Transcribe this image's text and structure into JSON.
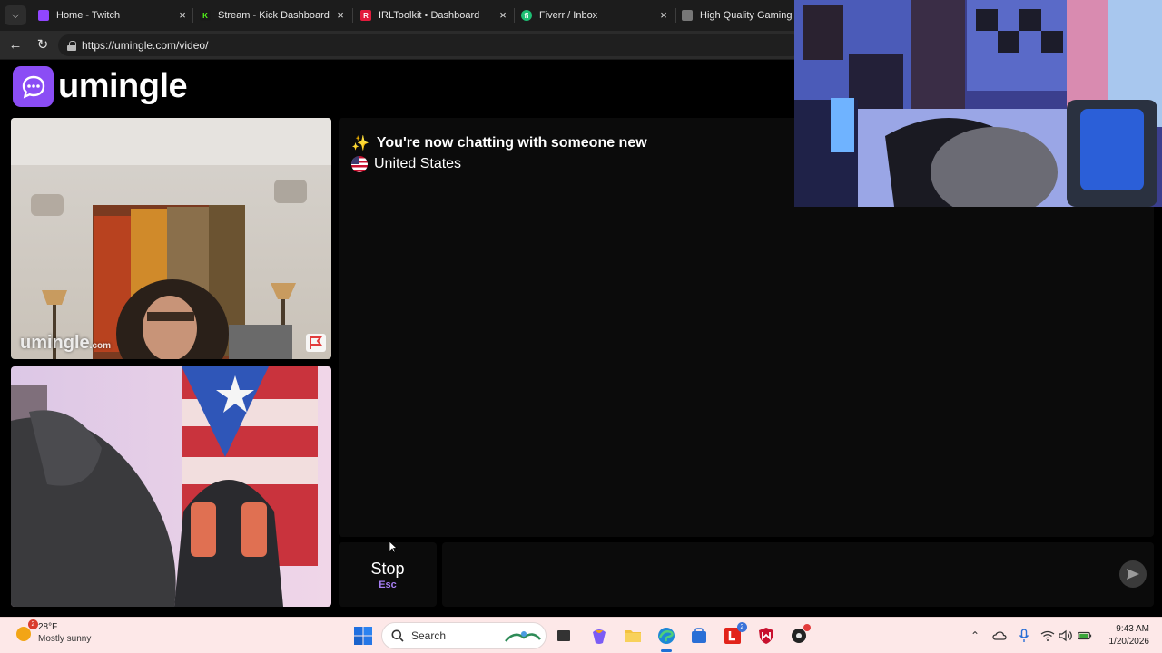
{
  "browser": {
    "tabs": [
      {
        "label": "Home - Twitch",
        "favicon": "twitch-icon",
        "color": "#9146ff"
      },
      {
        "label": "Stream - Kick Dashboard",
        "favicon": "kick-icon",
        "color": "#53fc18"
      },
      {
        "label": "IRLToolkit • Dashboard",
        "favicon": "irltoolkit-icon",
        "color": "#e21b3c"
      },
      {
        "label": "Fiverr / Inbox",
        "favicon": "fiverr-icon",
        "color": "#1dbf73"
      },
      {
        "label": "High Quality Gaming Ge",
        "favicon": "page-icon",
        "color": "#888888"
      }
    ],
    "url": "https://umingle.com/video/"
  },
  "page": {
    "logo_text": "umingle",
    "brand_color": "#8b4df5",
    "watermark": "umingle",
    "watermark_suffix": ".com",
    "chat": {
      "system_message": "You're now chatting with someone new",
      "country": "United States"
    },
    "stop": {
      "label": "Stop",
      "hint": "Esc"
    }
  },
  "taskbar": {
    "weather": {
      "temp": "28°F",
      "condition": "Mostly sunny",
      "badge": "2"
    },
    "search_placeholder": "Search",
    "store_badge": "2",
    "clock": {
      "time": "9:43 AM",
      "date": "1/20/2026"
    }
  }
}
